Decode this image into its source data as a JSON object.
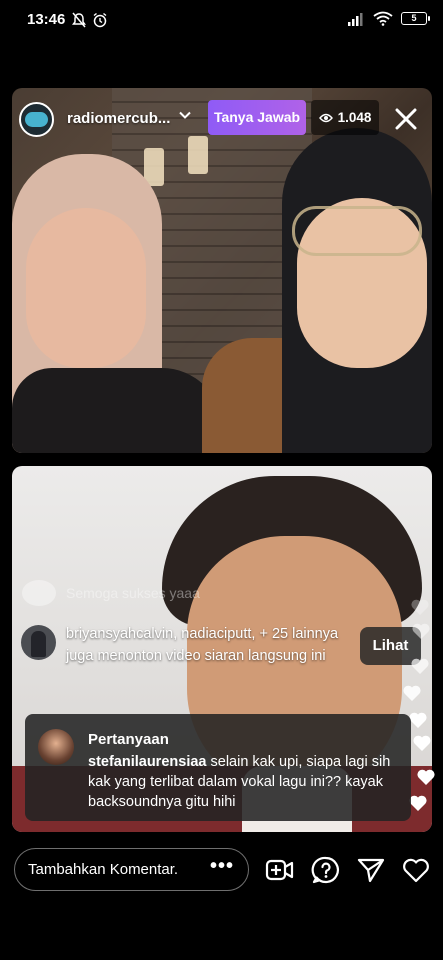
{
  "status_bar": {
    "time": "13:46",
    "battery": "5"
  },
  "header": {
    "host_name": "radiomercub...",
    "tanya_label": "Tanya Jawab",
    "viewer_count": "1.048"
  },
  "comments": {
    "faded_text": "Semoga sukses yaaa",
    "joined_text": "briyansyahcalvin, nadiaciputt, + 25 lainnya juga menonton video siaran langsung ini",
    "lihat_label": "Lihat"
  },
  "question": {
    "title": "Pertanyaan",
    "username": "stefanilaurensiaa",
    "text": " selain kak upi, siapa lagi sih kak yang terlibat dalam vokal lagu ini?? kayak backsoundnya gitu hihi"
  },
  "bottom": {
    "comment_placeholder": "Tambahkan Komentar.",
    "more_label": "•••"
  },
  "colors": {
    "tanya_gradient_start": "#8f5bf6",
    "tanya_gradient_end": "#b062e8",
    "background": "#000000"
  },
  "icons": [
    "mute-icon",
    "alarm-icon",
    "signal-icon",
    "wifi-icon",
    "battery-icon",
    "eye-icon",
    "close-icon",
    "add-video-icon",
    "question-icon",
    "send-icon",
    "heart-icon"
  ]
}
